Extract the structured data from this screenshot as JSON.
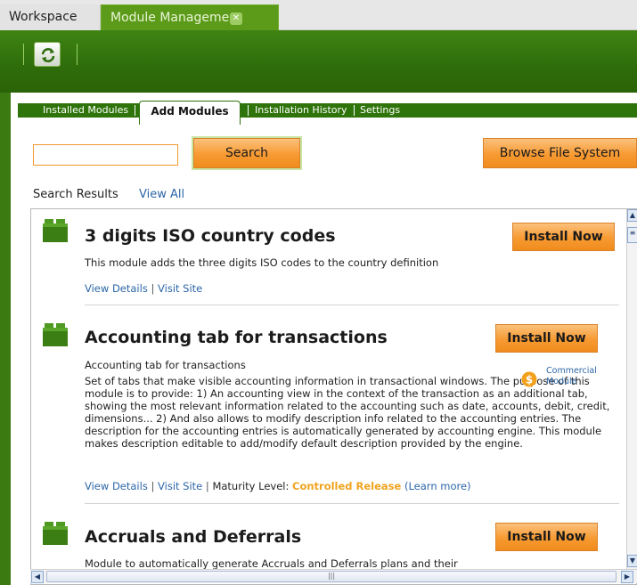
{
  "tabs": {
    "workspace": "Workspace",
    "module_management": "Module Management"
  },
  "subtabs": [
    "Installed Modules",
    "Add Modules",
    "Installation History",
    "Settings"
  ],
  "search": {
    "value": "",
    "button": "Search",
    "browse": "Browse File System"
  },
  "results_header": {
    "label": "Search Results",
    "view_all": "View All"
  },
  "modules": [
    {
      "title": "3 digits ISO country codes",
      "description": "This module adds the three digits ISO codes to the country definition",
      "view_details": "View Details",
      "visit_site": "Visit Site",
      "install": "Install Now"
    },
    {
      "title": "Accounting tab for transactions",
      "subtitle": "Accounting tab for transactions",
      "description": "Set of tabs that make visible accounting information in transactional windows. The purpose of this module is to provide: 1) An accounting view in the context of the transaction as an additional tab, showing the most relevant information related to the accounting such as date, accounts, debit, credit, dimensions... 2) And also allows to modify description info related to the accounting entries. The description for the accounting entries is automatically generated by accounting engine. This module makes description editable to add/modify default description provided by the engine.",
      "commercial_label": "Commercial Module",
      "view_details": "View Details",
      "visit_site": "Visit Site",
      "maturity_label": "Maturity Level:",
      "maturity_value": "Controlled Release",
      "learn_more": "(Learn more)",
      "install": "Install Now"
    },
    {
      "title": "Accruals and Deferrals",
      "description": "Module to automatically generate Accruals and Deferrals plans and their",
      "install": "Install Now"
    }
  ],
  "colors": {
    "brand_green": "#2f740b",
    "tab_green": "#5c9a1a",
    "accent_orange": "#f79a32",
    "link_blue": "#2c66a8",
    "maturity_orange": "#f0a31d"
  },
  "icons": {
    "refresh": "refresh-icon",
    "close": "close-icon",
    "module": "module-icon",
    "commercial": "dollar-icon"
  }
}
